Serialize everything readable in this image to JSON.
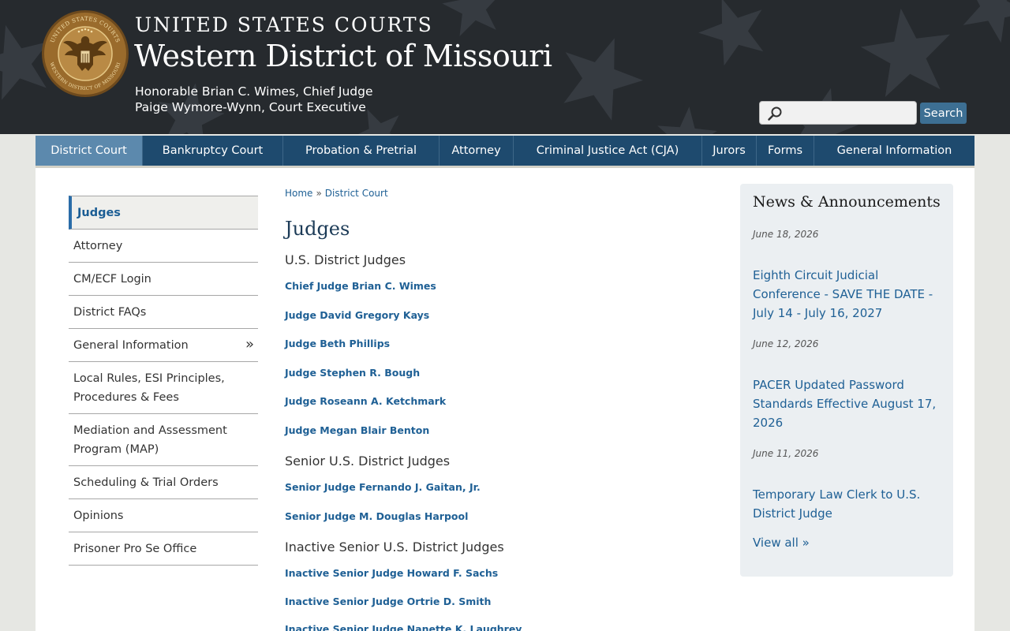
{
  "header": {
    "kicker": "UNITED STATES COURTS",
    "title": "Western District of Missouri",
    "line1": "Honorable Brian C. Wimes, Chief Judge",
    "line2": "Paige Wymore-Wynn, Court Executive",
    "seal_top_text": "UNITED STATES COURTS",
    "seal_bottom_text": "WESTERN DISTRICT OF MISSOURI"
  },
  "search": {
    "placeholder": "",
    "button_label": "Search"
  },
  "nav": {
    "items": [
      {
        "label": "District Court",
        "active": true
      },
      {
        "label": "Bankruptcy Court"
      },
      {
        "label": "Probation & Pretrial"
      },
      {
        "label": "Attorney"
      },
      {
        "label": "Criminal Justice Act (CJA)"
      },
      {
        "label": "Jurors"
      },
      {
        "label": "Forms"
      },
      {
        "label": "General Information"
      }
    ]
  },
  "sidebar": {
    "items": [
      {
        "label": "Judges",
        "active": true
      },
      {
        "label": "Attorney"
      },
      {
        "label": "CM/ECF Login"
      },
      {
        "label": "District FAQs"
      },
      {
        "label": "General Information",
        "chevron": "»"
      },
      {
        "label": "Local Rules, ESI Principles, Procedures & Fees"
      },
      {
        "label": "Mediation and Assessment Program (MAP)"
      },
      {
        "label": "Scheduling & Trial Orders"
      },
      {
        "label": "Opinions"
      },
      {
        "label": "Prisoner Pro Se Office"
      }
    ]
  },
  "breadcrumb": {
    "home": "Home",
    "sep": "»",
    "current": "District Court"
  },
  "main": {
    "title": "Judges",
    "sections": [
      {
        "heading": "U.S. District Judges",
        "links": [
          "Chief Judge Brian C. Wimes",
          "Judge David Gregory Kays",
          "Judge Beth Phillips",
          "Judge Stephen R. Bough",
          "Judge Roseann A. Ketchmark",
          "Judge Megan Blair Benton"
        ]
      },
      {
        "heading": "Senior U.S. District Judges",
        "links": [
          "Senior Judge Fernando J. Gaitan, Jr.",
          "Senior Judge M. Douglas Harpool"
        ]
      },
      {
        "heading": "Inactive Senior U.S. District Judges",
        "links": [
          "Inactive Senior Judge Howard F. Sachs",
          "Inactive Senior Judge Ortrie D. Smith",
          "Inactive Senior Judge Nanette K. Laughrey"
        ]
      }
    ]
  },
  "news": {
    "title": "News & Announcements",
    "items": [
      {
        "date": "June 18, 2026",
        "title": "Eighth Circuit Judicial Conference - SAVE THE DATE - July 14 - July 16, 2027"
      },
      {
        "date": "June 12, 2026",
        "title": "PACER Updated Password Standards Effective August 17, 2026"
      },
      {
        "date": "June 11, 2026",
        "title": "Temporary Law Clerk to U.S. District Judge"
      }
    ],
    "view_all": "View all »"
  },
  "colors": {
    "header_bg": "#262a2e",
    "nav_bg": "#1e4a6e",
    "nav_active": "#5c89ad",
    "link": "#1f6095",
    "news_bg": "#ebeff2",
    "search_button": "#3d6f93"
  }
}
